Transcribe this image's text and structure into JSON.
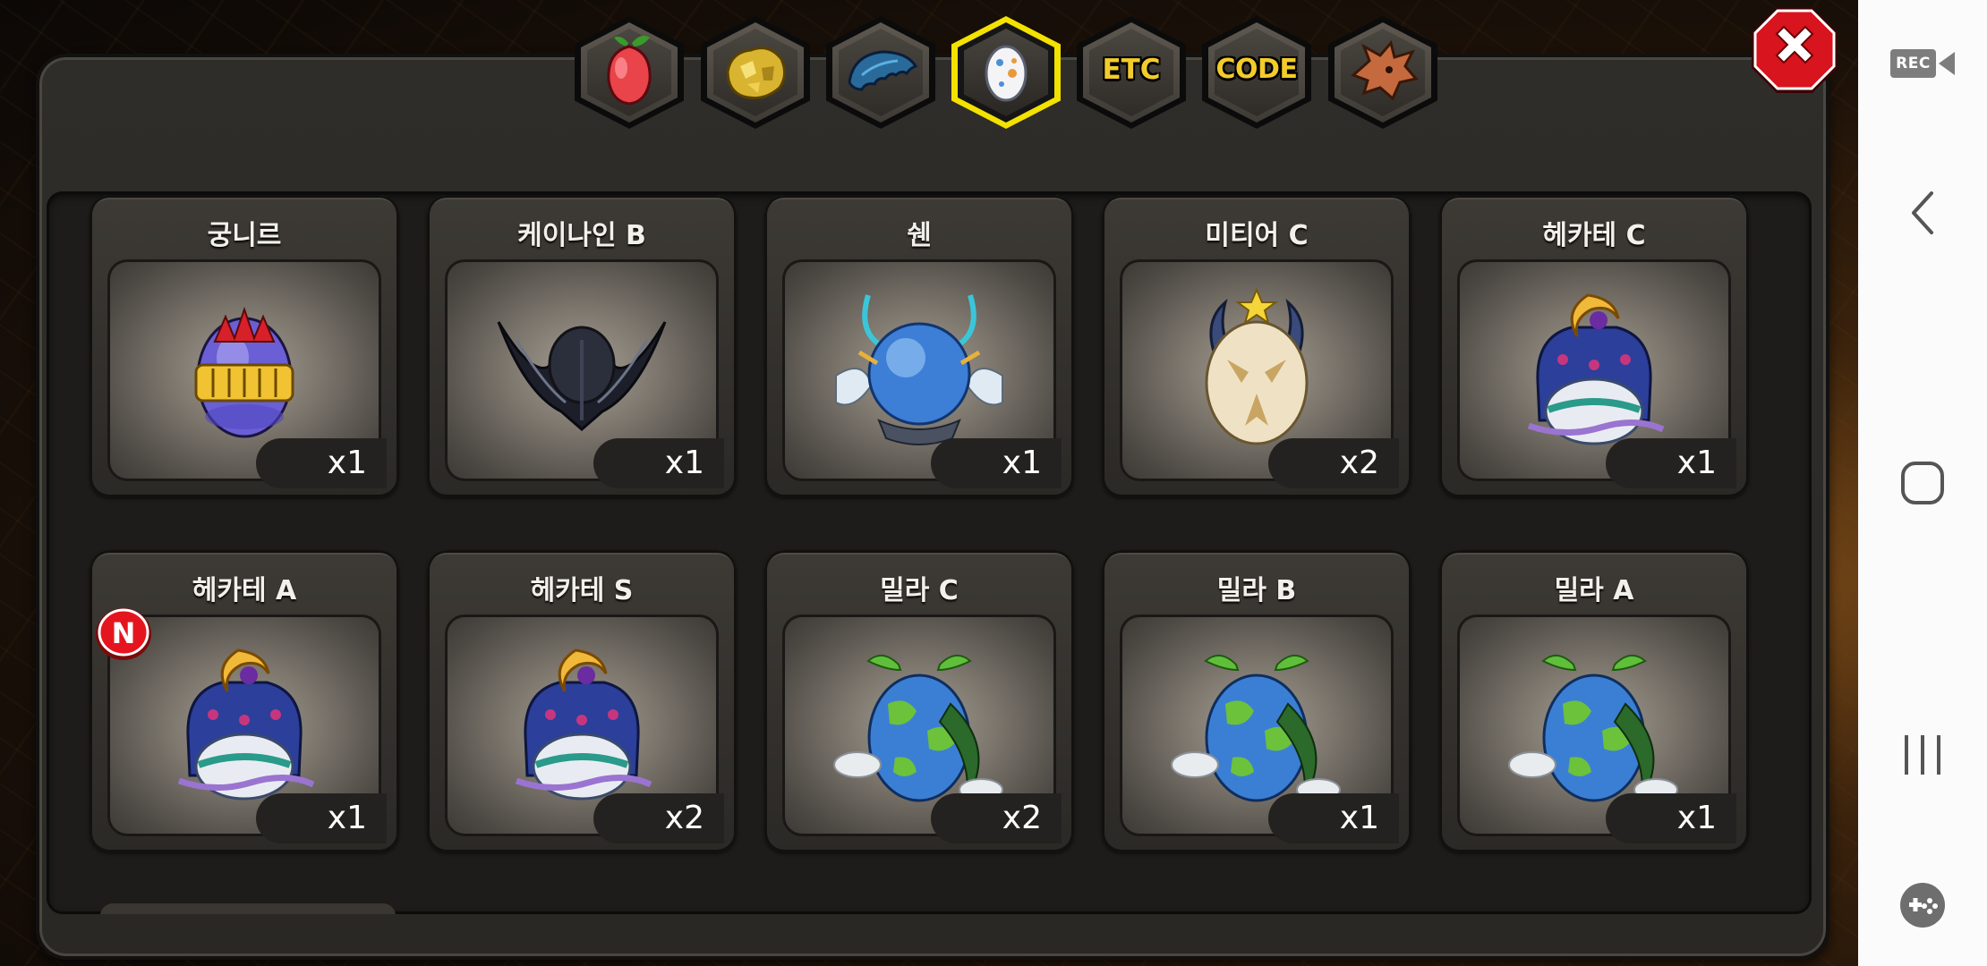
{
  "tabs": [
    {
      "id": "fruit",
      "icon": "fruit-icon",
      "label": ""
    },
    {
      "id": "ore",
      "icon": "ore-icon",
      "label": ""
    },
    {
      "id": "scale",
      "icon": "scale-icon",
      "label": ""
    },
    {
      "id": "egg",
      "icon": "egg-icon",
      "label": "",
      "active": true
    },
    {
      "id": "etc",
      "icon": "",
      "label": "ETC"
    },
    {
      "id": "code",
      "icon": "",
      "label": "CODE"
    },
    {
      "id": "dragon",
      "icon": "dragon-head-icon",
      "label": ""
    }
  ],
  "close_button": {
    "icon": "close-icon"
  },
  "items": [
    {
      "name": "궁니르",
      "qty": "x1",
      "egg": "gungnir-egg-icon"
    },
    {
      "name": "케이나인 B",
      "qty": "x1",
      "egg": "canine-egg-icon"
    },
    {
      "name": "쉔",
      "qty": "x1",
      "egg": "shen-egg-icon"
    },
    {
      "name": "미티어 C",
      "qty": "x2",
      "egg": "meteor-egg-icon"
    },
    {
      "name": "헤카테 C",
      "qty": "x1",
      "egg": "hecate-egg-icon"
    },
    {
      "name": "헤카테 A",
      "qty": "x1",
      "egg": "hecate-egg-icon",
      "new": true
    },
    {
      "name": "헤카테 S",
      "qty": "x2",
      "egg": "hecate-egg-icon"
    },
    {
      "name": "밀라 C",
      "qty": "x2",
      "egg": "mila-egg-icon"
    },
    {
      "name": "밀라 B",
      "qty": "x1",
      "egg": "mila-egg-icon"
    },
    {
      "name": "밀라 A",
      "qty": "x1",
      "egg": "mila-egg-icon"
    }
  ],
  "new_badge": {
    "label": "N"
  },
  "system_bar": {
    "rec_label": "REC",
    "buttons": [
      "back-icon",
      "home-icon",
      "recents-icon",
      "game-tools-icon"
    ]
  },
  "colors": {
    "active_tab_border": "#f3e100",
    "tab_text": "#f3cc2a",
    "close_red": "#d8141e"
  }
}
